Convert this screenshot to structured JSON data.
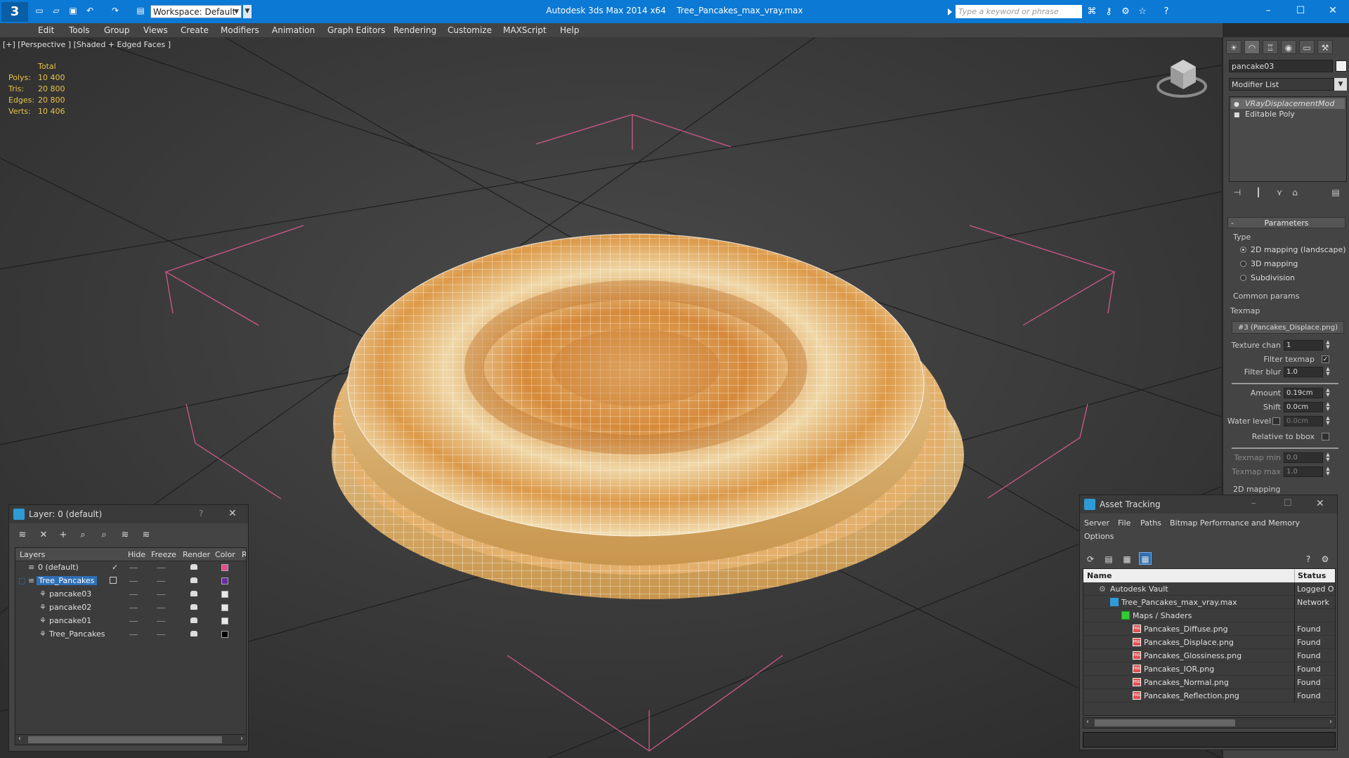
{
  "app": {
    "title": "Autodesk 3ds Max  2014 x64",
    "file": "Tree_Pancakes_max_vray.max",
    "workspace": "Workspace: Default",
    "search_placeholder": "Type a keyword or phrase"
  },
  "menu": [
    "Edit",
    "Tools",
    "Group",
    "Views",
    "Create",
    "Modifiers",
    "Animation",
    "Graph Editors",
    "Rendering",
    "Customize",
    "MAXScript",
    "Help"
  ],
  "viewport": {
    "label": "[+] [Perspective ] [Shaded + Edged Faces ]",
    "stats_header": "Total",
    "stats": [
      {
        "label": "Polys:",
        "value": "10 400"
      },
      {
        "label": "Tris:",
        "value": "20 800"
      },
      {
        "label": "Edges:",
        "value": "20 800"
      },
      {
        "label": "Verts:",
        "value": "10 406"
      }
    ]
  },
  "command_panel": {
    "object_name": "pancake03",
    "modifier_list": "Modifier List",
    "stack": [
      "VRayDisplacementMod",
      "Editable Poly"
    ],
    "parameters_title": "Parameters",
    "type_label": "Type",
    "radios": [
      {
        "label": "2D mapping (landscape)",
        "checked": true
      },
      {
        "label": "3D mapping",
        "checked": false
      },
      {
        "label": "Subdivision",
        "checked": false
      }
    ],
    "common_params": "Common params",
    "texmap_label": "Texmap",
    "texmap_value": "#3 (Pancakes_Displace.png)",
    "texture_chan_label": "Texture chan",
    "texture_chan_value": "1",
    "filter_texmap_label": "Filter texmap",
    "filter_blur_label": "Filter blur",
    "filter_blur_value": "1.0",
    "amount_label": "Amount",
    "amount_value": "0.19cm",
    "shift_label": "Shift",
    "shift_value": "0.0cm",
    "water_level_label": "Water level",
    "water_level_value": "0.0cm",
    "relative_bbox_label": "Relative to bbox",
    "texmap_min_label": "Texmap min",
    "texmap_min_value": "0.0",
    "texmap_max_label": "Texmap max",
    "texmap_max_value": "1.0",
    "mapping_2d": "2D mapping"
  },
  "layer_panel": {
    "title": "Layer: 0 (default)",
    "help": "?",
    "columns": [
      "Layers",
      "Hide",
      "Freeze",
      "Render",
      "Color",
      "R"
    ],
    "rows": [
      {
        "name": "0 (default)",
        "color": "#e0508a"
      },
      {
        "name": "Tree_Pancakes",
        "color": "#6a2aa0"
      },
      {
        "name": "pancake03",
        "color": "#e8e8e8"
      },
      {
        "name": "pancake02",
        "color": "#e8e8e8"
      },
      {
        "name": "pancake01",
        "color": "#e8e8e8"
      },
      {
        "name": "Tree_Pancakes",
        "color": "#000000"
      }
    ]
  },
  "asset_panel": {
    "title": "Asset Tracking",
    "menu": [
      "Server",
      "File",
      "Paths",
      "Bitmap Performance and Memory",
      "Options"
    ],
    "columns": [
      "Name",
      "Status"
    ],
    "rows": [
      {
        "name": "Autodesk Vault",
        "status": "Logged O"
      },
      {
        "name": "Tree_Pancakes_max_vray.max",
        "status": "Network"
      },
      {
        "name": "Maps / Shaders",
        "status": ""
      },
      {
        "name": "Pancakes_Diffuse.png",
        "status": "Found"
      },
      {
        "name": "Pancakes_Displace.png",
        "status": "Found"
      },
      {
        "name": "Pancakes_Glossiness.png",
        "status": "Found"
      },
      {
        "name": "Pancakes_IOR.png",
        "status": "Found"
      },
      {
        "name": "Pancakes_Normal.png",
        "status": "Found"
      },
      {
        "name": "Pancakes_Reflection.png",
        "status": "Found"
      }
    ]
  }
}
